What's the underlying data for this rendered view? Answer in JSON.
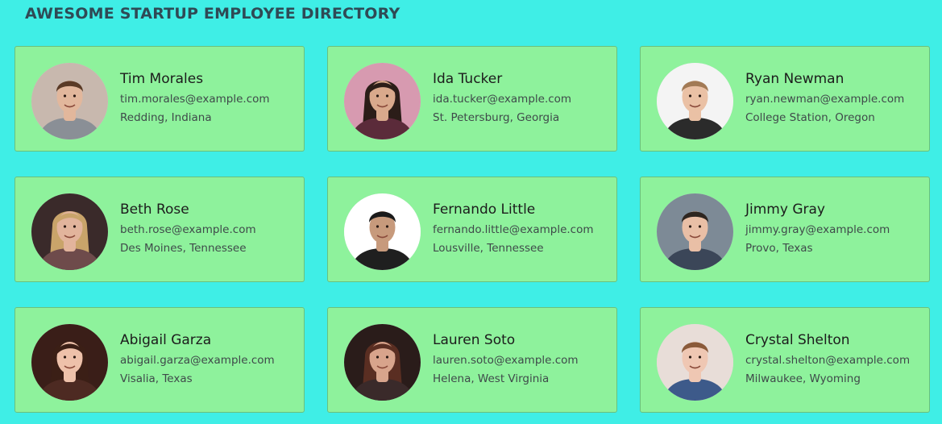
{
  "page": {
    "title": "AWESOME STARTUP EMPLOYEE DIRECTORY"
  },
  "employees": [
    {
      "name": "Tim Morales",
      "email": "tim.morales@example.com",
      "location": "Redding, Indiana",
      "avatar": {
        "bg": "#c8b8ae",
        "skin": "#e2b79c",
        "hair": "#5a3a26",
        "shirt": "#8a8f96"
      }
    },
    {
      "name": "Ida Tucker",
      "email": "ida.tucker@example.com",
      "location": "St. Petersburg, Georgia",
      "avatar": {
        "bg": "#d79ab0",
        "skin": "#d9a98c",
        "hair": "#2b1d18",
        "shirt": "#5b2b3a"
      }
    },
    {
      "name": "Ryan Newman",
      "email": "ryan.newman@example.com",
      "location": "College Station, Oregon",
      "avatar": {
        "bg": "#f4f4f4",
        "skin": "#eac1a5",
        "hair": "#a27a55",
        "shirt": "#2b2b2b"
      }
    },
    {
      "name": "Beth Rose",
      "email": "beth.rose@example.com",
      "location": "Des Moines, Tennessee",
      "avatar": {
        "bg": "#3a2a2a",
        "skin": "#e2b49c",
        "hair": "#c9a46a",
        "shirt": "#6e4b4b"
      }
    },
    {
      "name": "Fernando Little",
      "email": "fernando.little@example.com",
      "location": "Lousville, Tennessee",
      "avatar": {
        "bg": "#ffffff",
        "skin": "#c79a7c",
        "hair": "#1a1a1a",
        "shirt": "#1f1f1f"
      }
    },
    {
      "name": "Jimmy Gray",
      "email": "jimmy.gray@example.com",
      "location": "Provo, Texas",
      "avatar": {
        "bg": "#7d8a96",
        "skin": "#e9bfa6",
        "hair": "#2e2620",
        "shirt": "#3b4658"
      }
    },
    {
      "name": "Abigail Garza",
      "email": "abigail.garza@example.com",
      "location": "Visalia, Texas",
      "avatar": {
        "bg": "#3a1e18",
        "skin": "#eec1aa",
        "hair": "#3b1f16",
        "shirt": "#4d2a22"
      }
    },
    {
      "name": "Lauren Soto",
      "email": "lauren.soto@example.com",
      "location": "Helena, West Virginia",
      "avatar": {
        "bg": "#2a1c1a",
        "skin": "#d8a48c",
        "hair": "#5a2e22",
        "shirt": "#3a2a2a"
      }
    },
    {
      "name": "Crystal Shelton",
      "email": "crystal.shelton@example.com",
      "location": "Milwaukee, Wyoming",
      "avatar": {
        "bg": "#e8ddd8",
        "skin": "#efc7b3",
        "hair": "#8a5a3a",
        "shirt": "#3d5a8a"
      }
    }
  ],
  "colors": {
    "background": "#3feee6",
    "card": "#8ef29c",
    "card_border": "#6ac17c",
    "title_text": "#2f4a55"
  }
}
